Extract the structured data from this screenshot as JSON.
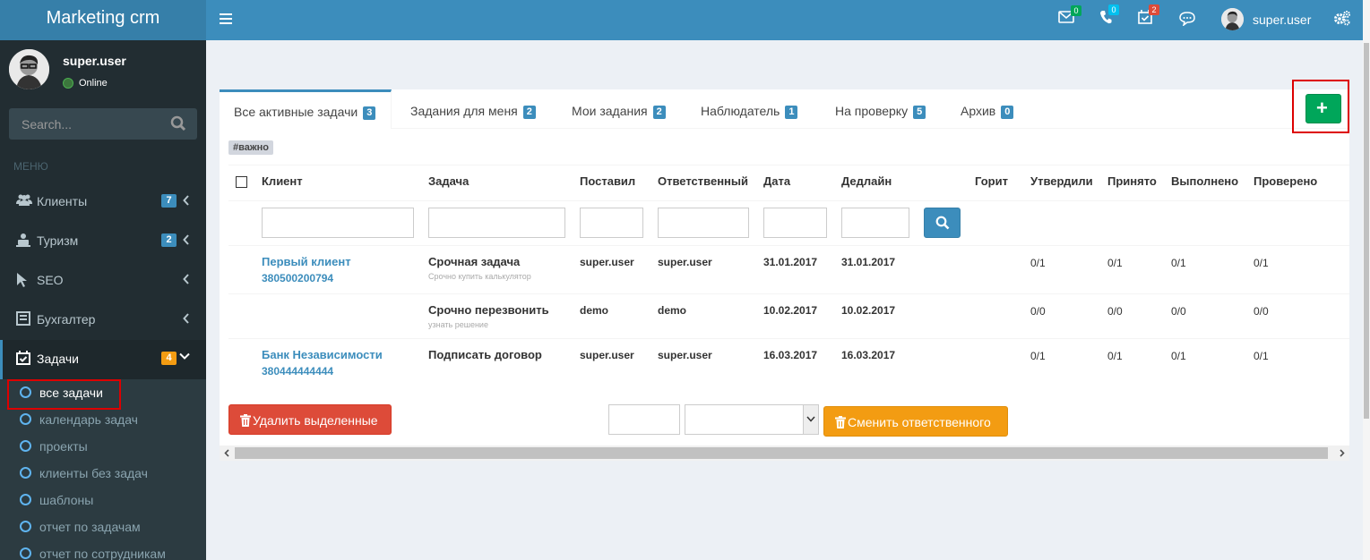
{
  "app": {
    "title": "Marketing crm"
  },
  "user": {
    "name": "super.user",
    "status": "Online"
  },
  "search": {
    "placeholder": "Search..."
  },
  "sidebar": {
    "menu_header": "МЕНЮ",
    "items": [
      {
        "label": "Клиенты",
        "badge": "7",
        "icon": "users-icon"
      },
      {
        "label": "Туризм",
        "badge": "2",
        "icon": "suitcase-icon"
      },
      {
        "label": "SEO",
        "badge": "",
        "icon": "cursor-icon"
      },
      {
        "label": "Бухгалтер",
        "badge": "",
        "icon": "book-icon"
      },
      {
        "label": "Задачи",
        "badge": "4",
        "icon": "calendar-check-icon"
      }
    ],
    "subitems": [
      "все задачи",
      "календарь задач",
      "проекты",
      "клиенты без задач",
      "шаблоны",
      "отчет по задачам",
      "отчет по сотрудникам"
    ]
  },
  "topbar": {
    "mail_badge": "0",
    "phone_badge": "0",
    "tasks_badge": "2",
    "user_name": "super.user"
  },
  "tabs": [
    {
      "label": "Все активные задачи",
      "badge": "3"
    },
    {
      "label": "Задания для меня",
      "badge": "2"
    },
    {
      "label": "Мои задания",
      "badge": "2"
    },
    {
      "label": "Наблюдатель",
      "badge": "1"
    },
    {
      "label": "На проверку",
      "badge": "5"
    },
    {
      "label": "Архив",
      "badge": "0"
    }
  ],
  "tag": "#важно",
  "table": {
    "headers": [
      "Клиент",
      "Задача",
      "Поставил",
      "Ответственный",
      "Дата",
      "Дедлайн",
      "Горит",
      "Утвердили",
      "Принято",
      "Выполнено",
      "Проверено"
    ],
    "rows": [
      {
        "client": "Первый клиент",
        "phone": "380500200794",
        "task": "Срочная задача",
        "note": "Срочно купить калькулятор",
        "set_by": "super.user",
        "responsible": "super.user",
        "date": "31.01.2017",
        "deadline": "31.01.2017",
        "approved": "0/1",
        "accepted": "0/1",
        "done": "0/1",
        "checked": "0/1"
      },
      {
        "client": "",
        "phone": "",
        "task": "Срочно перезвонить",
        "note": "узнать решение",
        "set_by": "demo",
        "responsible": "demo",
        "date": "10.02.2017",
        "deadline": "10.02.2017",
        "approved": "0/0",
        "accepted": "0/0",
        "done": "0/0",
        "checked": "0/0"
      },
      {
        "client": "Банк Независимости",
        "phone": "380444444444",
        "task": "Подписать договор",
        "note": "",
        "set_by": "super.user",
        "responsible": "super.user",
        "date": "16.03.2017",
        "deadline": "16.03.2017",
        "approved": "0/1",
        "accepted": "0/1",
        "done": "0/1",
        "checked": "0/1"
      }
    ]
  },
  "actions": {
    "delete_label": "Удалить выделенные",
    "change_label": "Сменить ответственного"
  },
  "colors": {
    "primary": "#3c8dbc",
    "sidebar": "#222d32",
    "success": "#00a65a",
    "danger": "#dd4b39",
    "warning": "#f39c12"
  }
}
